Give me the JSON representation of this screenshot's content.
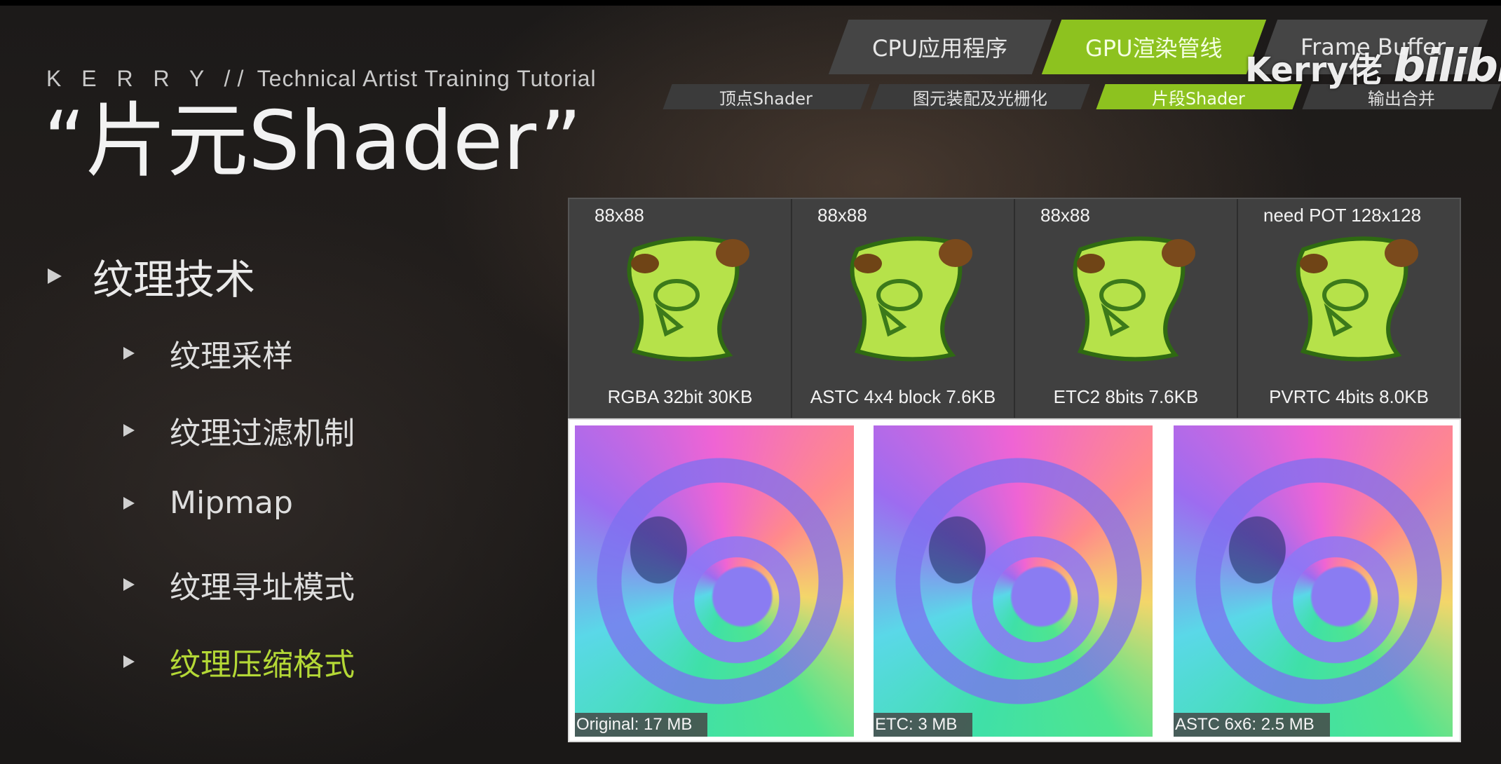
{
  "header": {
    "brand_name": "K E R R Y //",
    "brand_subtitle": "Technical Artist Training Tutorial",
    "title": "“片元Shader”"
  },
  "outline": {
    "main": "纹理技术",
    "items": [
      {
        "label": "纹理采样",
        "active": false
      },
      {
        "label": "纹理过滤机制",
        "active": false
      },
      {
        "label": "Mipmap",
        "active": false
      },
      {
        "label": "纹理寻址模式",
        "active": false
      },
      {
        "label": "纹理压缩格式",
        "active": true
      }
    ]
  },
  "pipeline": {
    "stages": [
      {
        "label": "CPU应用程序",
        "active": false
      },
      {
        "label": "GPU渲染管线",
        "active": true
      },
      {
        "label": "Frame Buffer",
        "active": false
      }
    ],
    "substages": [
      {
        "label": "顶点Shader",
        "active": false
      },
      {
        "label": "图元装配及光栅化",
        "active": false
      },
      {
        "label": "片段Shader",
        "active": true
      },
      {
        "label": "输出合并",
        "active": false
      }
    ]
  },
  "watermark": {
    "author": "Kerry佬",
    "site": "bilibili"
  },
  "textures": [
    {
      "size": "88x88",
      "caption": "RGBA 32bit 30KB"
    },
    {
      "size": "88x88",
      "caption": "ASTC 4x4 block 7.6KB"
    },
    {
      "size": "88x88",
      "caption": "ETC2 8bits 7.6KB"
    },
    {
      "size": "need POT 128x128",
      "caption": "PVRTC 4bits 8.0KB"
    }
  ],
  "normal_maps": [
    {
      "label": "Original: 17 MB"
    },
    {
      "label": "ETC: 3 MB"
    },
    {
      "label": "ASTC 6x6: 2.5 MB"
    }
  ],
  "colors": {
    "accent": "#8dc21f",
    "active_text": "#b4d836",
    "tab_bg": "#454545"
  }
}
